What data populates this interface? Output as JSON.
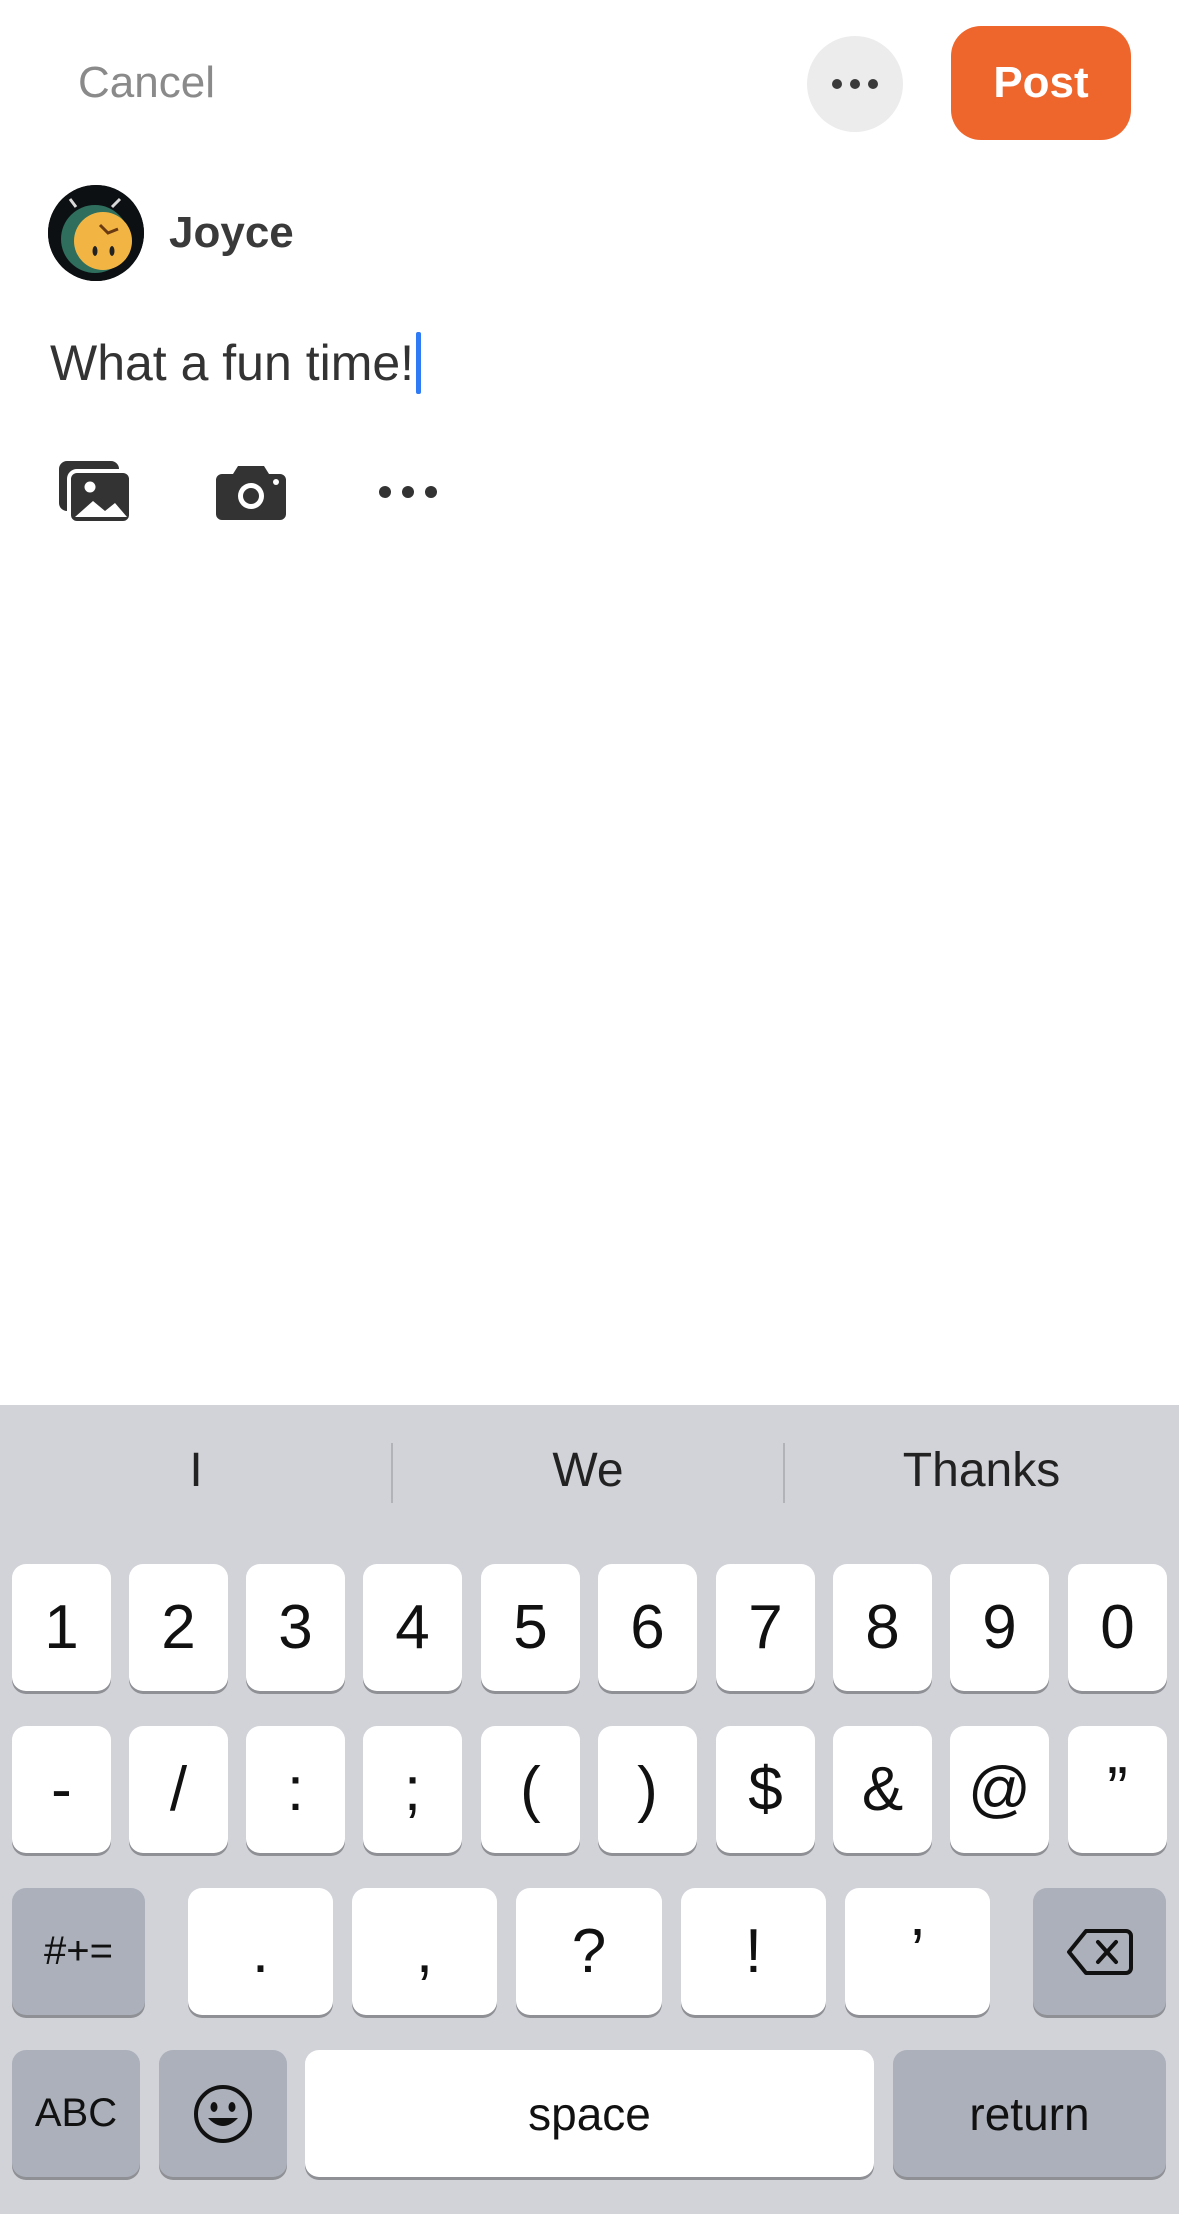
{
  "header": {
    "cancel_label": "Cancel",
    "more_icon": "ellipsis-icon",
    "post_label": "Post",
    "post_color": "#ef662c"
  },
  "author": {
    "name": "Joyce",
    "avatar_icon": "alarm-clock-avatar"
  },
  "composer": {
    "text": "What a fun time!",
    "caret_color": "#2f7bf5"
  },
  "toolbar": {
    "gallery_icon": "photo-gallery-icon",
    "camera_icon": "camera-icon",
    "more_icon": "ellipsis-icon"
  },
  "keyboard": {
    "suggestions": [
      "I",
      "We",
      "Thanks"
    ],
    "row1": [
      "1",
      "2",
      "3",
      "4",
      "5",
      "6",
      "7",
      "8",
      "9",
      "0"
    ],
    "row2": [
      "-",
      "/",
      ":",
      ";",
      "(",
      ")",
      "$",
      "&",
      "@",
      "”"
    ],
    "row3": {
      "shift_label": "#+=",
      "keys": [
        ".",
        ",",
        "?",
        "!",
        "’"
      ],
      "delete_icon": "backspace-icon"
    },
    "row4": {
      "abc_label": "ABC",
      "emoji_icon": "emoji-icon",
      "space_label": "space",
      "return_label": "return"
    }
  }
}
